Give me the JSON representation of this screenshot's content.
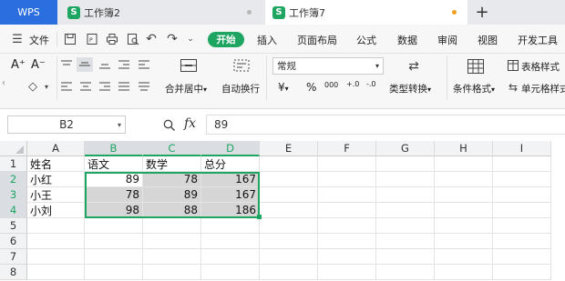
{
  "colors": {
    "accent": "#1fa562",
    "wps_blue": "#2b6ee0",
    "dot_gray": "#b8b8b8",
    "dot_orange": "#f0a020",
    "selected_fill": "#d6d6d6"
  },
  "titlebar": {
    "app": "WPS",
    "tabs": [
      {
        "label": "工作簿2",
        "icon": "s-badge"
      },
      {
        "label": "工作簿7",
        "icon": "s-badge"
      }
    ],
    "new_tab": "+"
  },
  "menu": {
    "file": "文件",
    "start": "开始",
    "items": [
      "插入",
      "页面布局",
      "公式",
      "数据",
      "审阅",
      "视图",
      "开发工具"
    ]
  },
  "ribbon": {
    "font_inc": "A⁺",
    "font_dec": "A⁻",
    "merge": "合并居中",
    "wrap": "自动换行",
    "format_value": "常规",
    "currency": "¥",
    "percent": "%",
    "thousands": "000",
    "dec_inc": "+.0",
    "dec_dec": "-.0",
    "type_convert": "类型转换",
    "cond_format": "条件格式",
    "table_style": "表格样式",
    "cell_style": "单元格样式"
  },
  "formula_bar": {
    "cell_ref": "B2",
    "fx": "fx",
    "value": "89"
  },
  "sheet": {
    "columns": [
      "A",
      "B",
      "C",
      "D",
      "E",
      "F",
      "G",
      "H",
      "I"
    ],
    "rows": [
      "1",
      "2",
      "3",
      "4",
      "5",
      "6",
      "7",
      "8"
    ],
    "cells": {
      "A1": "姓名",
      "B1": "语文",
      "C1": "数学",
      "D1": "总分",
      "A2": "小红",
      "B2": "89",
      "C2": "78",
      "D2": "167",
      "A3": "小王",
      "B3": "78",
      "C3": "89",
      "D3": "167",
      "A4": "小刘",
      "B4": "98",
      "C4": "88",
      "D4": "186"
    }
  }
}
